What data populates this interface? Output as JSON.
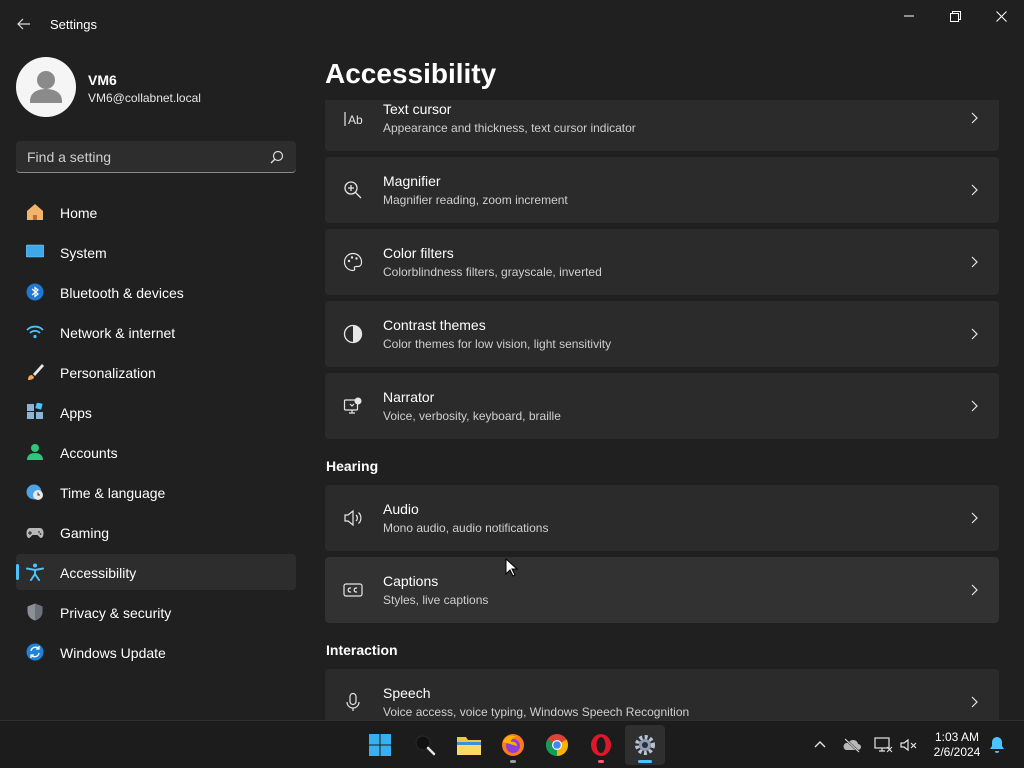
{
  "window": {
    "title": "Settings"
  },
  "profile": {
    "name": "VM6",
    "email": "VM6@collabnet.local"
  },
  "search": {
    "placeholder": "Find a setting"
  },
  "sidebar": {
    "items": [
      {
        "label": "Home",
        "icon": "home-icon"
      },
      {
        "label": "System",
        "icon": "system-icon"
      },
      {
        "label": "Bluetooth & devices",
        "icon": "bluetooth-icon"
      },
      {
        "label": "Network & internet",
        "icon": "network-icon"
      },
      {
        "label": "Personalization",
        "icon": "brush-icon"
      },
      {
        "label": "Apps",
        "icon": "apps-icon"
      },
      {
        "label": "Accounts",
        "icon": "accounts-icon"
      },
      {
        "label": "Time & language",
        "icon": "clock-globe-icon"
      },
      {
        "label": "Gaming",
        "icon": "gamepad-icon"
      },
      {
        "label": "Accessibility",
        "icon": "accessibility-icon",
        "active": true
      },
      {
        "label": "Privacy & security",
        "icon": "shield-icon"
      },
      {
        "label": "Windows Update",
        "icon": "update-icon"
      }
    ]
  },
  "main": {
    "title": "Accessibility",
    "vision_items": [
      {
        "title": "Text cursor",
        "desc": "Appearance and thickness, text cursor indicator",
        "icon": "text-cursor-icon"
      },
      {
        "title": "Magnifier",
        "desc": "Magnifier reading, zoom increment",
        "icon": "magnifier-icon"
      },
      {
        "title": "Color filters",
        "desc": "Colorblindness filters, grayscale, inverted",
        "icon": "palette-icon"
      },
      {
        "title": "Contrast themes",
        "desc": "Color themes for low vision, light sensitivity",
        "icon": "contrast-icon"
      },
      {
        "title": "Narrator",
        "desc": "Voice, verbosity, keyboard, braille",
        "icon": "narrator-icon"
      }
    ],
    "hearing": {
      "heading": "Hearing",
      "items": [
        {
          "title": "Audio",
          "desc": "Mono audio, audio notifications",
          "icon": "speaker-icon"
        },
        {
          "title": "Captions",
          "desc": "Styles, live captions",
          "icon": "captions-icon"
        }
      ]
    },
    "interaction": {
      "heading": "Interaction",
      "items": [
        {
          "title": "Speech",
          "desc": "Voice access, voice typing, Windows Speech Recognition",
          "icon": "microphone-icon"
        }
      ]
    }
  },
  "taskbar": {
    "apps": [
      "start-icon",
      "search-icon",
      "file-explorer-icon",
      "firefox-icon",
      "chrome-icon",
      "opera-icon",
      "settings-icon"
    ],
    "time": "1:03 AM",
    "date": "2/6/2024"
  },
  "colors": {
    "background": "#202020",
    "card": "#2b2b2b",
    "accent": "#4cc2ff"
  }
}
